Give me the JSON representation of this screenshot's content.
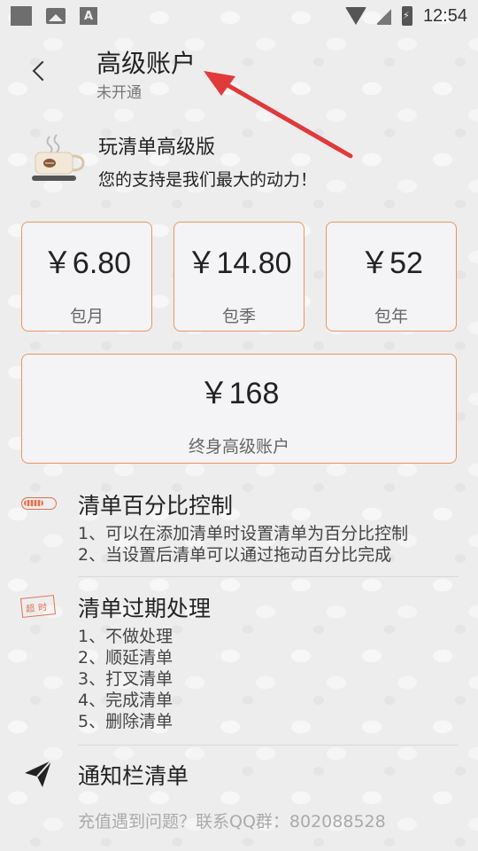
{
  "status_bar": {
    "time": "12:54",
    "a_icon": "A"
  },
  "header": {
    "title": "高级账户",
    "subtitle": "未开通"
  },
  "promo": {
    "title": "玩清单高级版",
    "text": "您的支持是我们最大的动力！"
  },
  "plans": [
    {
      "price": "￥6.80",
      "label": "包月"
    },
    {
      "price": "￥14.80",
      "label": "包季"
    },
    {
      "price": "￥52",
      "label": "包年"
    },
    {
      "price": "￥168",
      "label": "终身高级账户"
    }
  ],
  "features": [
    {
      "icon": "progress-bar-icon",
      "title": "清单百分比控制",
      "lines": [
        "1、可以在添加清单时设置清单为百分比控制",
        "2、当设置后清单可以通过拖动百分比完成"
      ]
    },
    {
      "icon": "overdue-stamp-icon",
      "title": "清单过期处理",
      "stamp_text": "超时",
      "lines": [
        "1、不做处理",
        "2、顺延清单",
        "3、打叉清单",
        "4、完成清单",
        "5、删除清单"
      ]
    },
    {
      "icon": "paper-plane-icon",
      "title": "通知栏清单",
      "lines": []
    }
  ],
  "footer": {
    "text": "充值遇到问题？联系QQ群：802088528"
  },
  "colors": {
    "accent": "#e69660",
    "arrow": "#e03a3a",
    "background": "#eeeded"
  }
}
